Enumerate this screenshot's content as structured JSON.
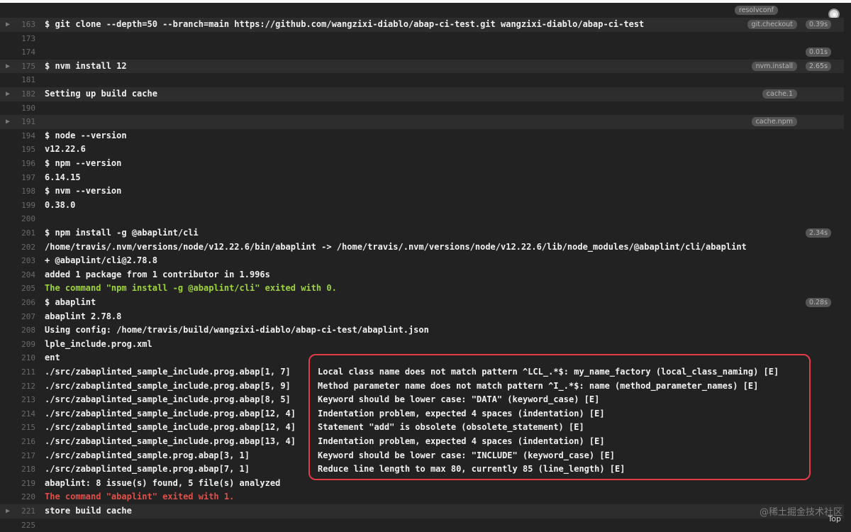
{
  "header": {
    "resolv_tag": "resolvconf"
  },
  "footer": {
    "top_label": "Top",
    "watermark": "@稀土掘金技术社区"
  },
  "lines": [
    {
      "num": "163",
      "text": "$ git clone --depth=50 --branch=main https://github.com/wangzixi-diablo/abap-ci-test.git wangzixi-diablo/abap-ci-test",
      "fold": true,
      "tag": "git.checkout",
      "duration": "0.39s"
    },
    {
      "num": "173",
      "text": ""
    },
    {
      "num": "174",
      "text": "",
      "duration": "0.01s"
    },
    {
      "num": "175",
      "text": "$ nvm install 12",
      "fold": true,
      "tag": "nvm.install",
      "duration": "2.65s"
    },
    {
      "num": "181",
      "text": ""
    },
    {
      "num": "182",
      "text": "Setting up build cache",
      "fold": true,
      "tag": "cache.1"
    },
    {
      "num": "190",
      "text": ""
    },
    {
      "num": "191",
      "text": "",
      "fold": true,
      "tag": "cache.npm"
    },
    {
      "num": "194",
      "text": "$ node --version"
    },
    {
      "num": "195",
      "text": "v12.22.6"
    },
    {
      "num": "196",
      "text": "$ npm --version"
    },
    {
      "num": "197",
      "text": "6.14.15"
    },
    {
      "num": "198",
      "text": "$ nvm --version"
    },
    {
      "num": "199",
      "text": "0.38.0"
    },
    {
      "num": "200",
      "text": ""
    },
    {
      "num": "201",
      "text": "$ npm install -g @abaplint/cli",
      "duration": "2.34s"
    },
    {
      "num": "202",
      "text": "/home/travis/.nvm/versions/node/v12.22.6/bin/abaplint -> /home/travis/.nvm/versions/node/v12.22.6/lib/node_modules/@abaplint/cli/abaplint"
    },
    {
      "num": "203",
      "text": "+ @abaplint/cli@2.78.8"
    },
    {
      "num": "204",
      "text": "added 1 package from 1 contributor in 1.996s"
    },
    {
      "num": "205",
      "text": "The command \"npm install -g @abaplint/cli\" exited with 0.",
      "color": "green"
    },
    {
      "num": "206",
      "text": "$ abaplint",
      "duration": "0.28s"
    },
    {
      "num": "207",
      "text": "abaplint 2.78.8"
    },
    {
      "num": "208",
      "text": "Using config: /home/travis/build/wangzixi-diablo/abap-ci-test/abaplint.json"
    },
    {
      "num": "209",
      "text": "lple_include.prog.xml"
    },
    {
      "num": "210",
      "text": "ent"
    },
    {
      "num": "211",
      "text": "./src/zabaplinted_sample_include.prog.abap[1, 7]",
      "msg": "Local class name does not match pattern ^LCL_.*$: my_name_factory (local_class_naming) [E]"
    },
    {
      "num": "212",
      "text": "./src/zabaplinted_sample_include.prog.abap[5, 9]",
      "msg": "Method parameter name does not match pattern ^I_.*$: name (method_parameter_names) [E]"
    },
    {
      "num": "213",
      "text": "./src/zabaplinted_sample_include.prog.abap[8, 5]",
      "msg": "Keyword should be lower case: \"DATA\" (keyword_case) [E]"
    },
    {
      "num": "214",
      "text": "./src/zabaplinted_sample_include.prog.abap[12, 4]",
      "msg": "Indentation problem, expected 4 spaces (indentation) [E]"
    },
    {
      "num": "215",
      "text": "./src/zabaplinted_sample_include.prog.abap[12, 4]",
      "msg": "Statement \"add\" is obsolete (obsolete_statement) [E]"
    },
    {
      "num": "216",
      "text": "./src/zabaplinted_sample_include.prog.abap[13, 4]",
      "msg": "Indentation problem, expected 4 spaces (indentation) [E]"
    },
    {
      "num": "217",
      "text": "./src/zabaplinted_sample.prog.abap[3, 1]",
      "msg": "Keyword should be lower case: \"INCLUDE\" (keyword_case) [E]"
    },
    {
      "num": "218",
      "text": "./src/zabaplinted_sample.prog.abap[7, 1]",
      "msg": "Reduce line length to max 80, currently 85 (line_length) [E]"
    },
    {
      "num": "219",
      "text": "abaplint: 8 issue(s) found, 5 file(s) analyzed"
    },
    {
      "num": "220",
      "text": "The command \"abaplint\" exited with 1.",
      "color": "red"
    },
    {
      "num": "221",
      "text": "store build cache",
      "fold": true
    },
    {
      "num": "225",
      "text": ""
    }
  ]
}
